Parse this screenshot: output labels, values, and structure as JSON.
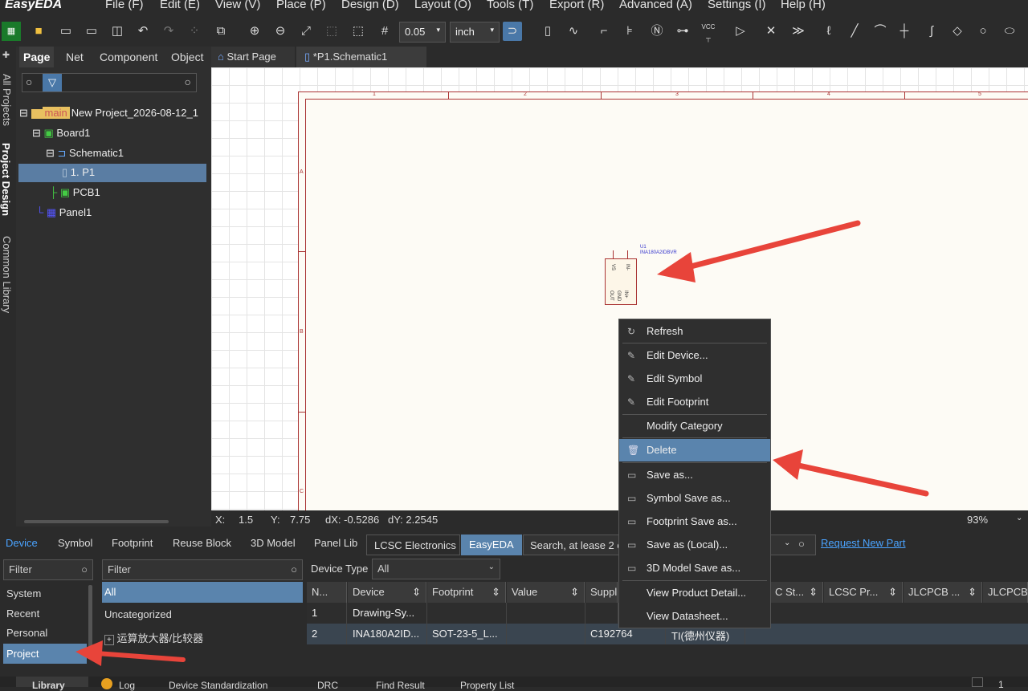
{
  "app": {
    "logo": "EasyEDA"
  },
  "menu": [
    "File (F)",
    "Edit (E)",
    "View (V)",
    "Place (P)",
    "Design (D)",
    "Layout (O)",
    "Tools (T)",
    "Export (R)",
    "Advanced (A)",
    "Settings (I)",
    "Help (H)"
  ],
  "toolbar": {
    "grid_value": "0.05",
    "unit": "inch",
    "vcc_label": "VCC"
  },
  "left_strip": [
    "All Projects",
    "Project Design",
    "Common Library"
  ],
  "panel": {
    "tabs": [
      "Page",
      "Net",
      "Component",
      "Object"
    ],
    "tree": [
      {
        "label": "main",
        "text": "New Project_2026-08-12_1"
      },
      {
        "text": "Board1"
      },
      {
        "text": "Schematic1"
      },
      {
        "text": "1. P1"
      },
      {
        "text": "PCB1"
      },
      {
        "text": "Panel1"
      }
    ]
  },
  "doc_tabs": [
    "Start Page",
    "*P1.Schematic1"
  ],
  "sheet": {
    "cols": [
      "1",
      "2",
      "3",
      "4",
      "5"
    ],
    "rows": [
      "A",
      "B",
      "C"
    ],
    "part_ref": "U1",
    "part_value": "INA180A2IDBVR",
    "pins": [
      "VS",
      "IN-",
      "OUT",
      "GND",
      "IN+"
    ]
  },
  "status": {
    "x_label": "X:",
    "x": "1.5",
    "y_label": "Y:",
    "y": "7.75",
    "dx": "dX: -0.5286",
    "dy": "dY: 2.2545",
    "zoom": "93%"
  },
  "lib": {
    "tabs": [
      "Device",
      "Symbol",
      "Footprint",
      "Reuse Block",
      "3D Model",
      "Panel Lib"
    ],
    "source_tabs": [
      "LCSC Electronics",
      "EasyEDA"
    ],
    "search_placeholder": "Search, at lease 2 c",
    "request": "Request New Part",
    "filter": "Filter",
    "categories": [
      "System",
      "Recent",
      "Personal",
      "Project"
    ],
    "groups": [
      "All",
      "Uncategorized",
      "运算放大器/比较器"
    ],
    "device_type_label": "Device Type",
    "device_type_value": "All",
    "columns": [
      "N...",
      "Device",
      "Footprint",
      "Value",
      "Suppli",
      "C St...",
      "LCSC Pr...",
      "JLCPCB ...",
      "JLCPCB"
    ],
    "rows": [
      [
        "1",
        "Drawing-Sy...",
        "",
        "",
        "",
        "",
        ""
      ],
      [
        "2",
        "INA180A2ID...",
        "SOT-23-5_L...",
        "",
        "C192764",
        "TI(德州仪器)",
        ""
      ]
    ]
  },
  "context_menu": [
    {
      "label": "Refresh",
      "icon": "refresh-icon"
    },
    {
      "label": "Edit Device...",
      "icon": "pencil-icon"
    },
    {
      "label": "Edit Symbol",
      "icon": "pencil-icon"
    },
    {
      "label": "Edit Footprint",
      "icon": "pencil-icon"
    },
    {
      "label": "Modify Category",
      "icon": ""
    },
    {
      "label": "Delete",
      "icon": "trash-icon"
    },
    {
      "label": "Save as...",
      "icon": "save-icon"
    },
    {
      "label": "Symbol Save as...",
      "icon": "save-icon"
    },
    {
      "label": "Footprint Save as...",
      "icon": "save-icon"
    },
    {
      "label": "Save as (Local)...",
      "icon": "save-icon"
    },
    {
      "label": "3D Model Save as...",
      "icon": "save-icon"
    },
    {
      "label": "View Product Detail...",
      "icon": ""
    },
    {
      "label": "View Datasheet...",
      "icon": ""
    }
  ],
  "bottom_tabs": [
    "Library",
    "Log",
    "Device Standardization",
    "DRC",
    "Find Result",
    "Property List"
  ],
  "bottom_page": "1"
}
